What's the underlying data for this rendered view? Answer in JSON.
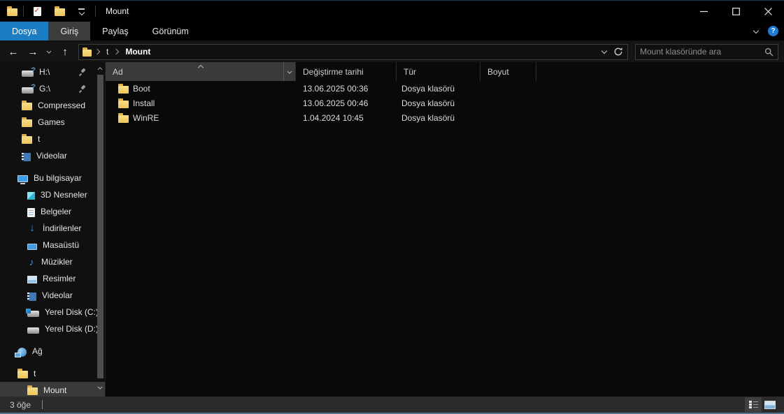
{
  "window": {
    "title": "Mount",
    "help_glyph": "?"
  },
  "titlebar": {
    "app_icon": "folder-icon",
    "quick_access_toolbar": [
      {
        "name": "properties-button",
        "icon": "properties-check-icon"
      },
      {
        "name": "new-folder-button",
        "icon": "folder-icon"
      },
      {
        "name": "customize-quick-access-button",
        "icon": "chevron-down-icon"
      }
    ]
  },
  "ribbon": {
    "tabs": [
      {
        "label": "Dosya",
        "style": "file-accent"
      },
      {
        "label": "Giriş",
        "style": "current"
      },
      {
        "label": "Paylaş",
        "style": "normal"
      },
      {
        "label": "Görünüm",
        "style": "normal"
      }
    ],
    "collapse_icon": "chevron-down-icon",
    "help_icon": "help-icon"
  },
  "navbar": {
    "back_icon": "←",
    "forward_icon": "→",
    "up_icon": "↑",
    "breadcrumb": {
      "root_icon": "folder-icon",
      "segments": [
        {
          "label": "t",
          "current": false
        },
        {
          "label": "Mount",
          "current": true
        }
      ]
    },
    "refresh_icon": "refresh-icon",
    "search": {
      "placeholder": "Mount klasöründe ara",
      "value": ""
    }
  },
  "sidebar": {
    "items": [
      {
        "label": "H:\\",
        "icon": "drive-question-icon",
        "level": 1,
        "pinned": true
      },
      {
        "label": "G:\\",
        "icon": "drive-question-icon",
        "level": 1,
        "pinned": true
      },
      {
        "label": "Compressed",
        "icon": "folder-icon",
        "level": 1,
        "pinned": false
      },
      {
        "label": "Games",
        "icon": "folder-icon",
        "level": 1,
        "pinned": false
      },
      {
        "label": "t",
        "icon": "folder-icon",
        "level": 1,
        "pinned": false
      },
      {
        "label": "Videolar",
        "icon": "videos-icon",
        "level": 1,
        "pinned": false
      },
      {
        "label": "Bu bilgisayar",
        "icon": "computer-icon",
        "level": 0,
        "pinned": false
      },
      {
        "label": "3D Nesneler",
        "icon": "3d-objects-icon",
        "level": 1,
        "pinned": false
      },
      {
        "label": "Belgeler",
        "icon": "documents-icon",
        "level": 1,
        "pinned": false
      },
      {
        "label": "İndirilenler",
        "icon": "downloads-icon",
        "level": 1,
        "pinned": false
      },
      {
        "label": "Masaüstü",
        "icon": "desktop-icon",
        "level": 1,
        "pinned": false
      },
      {
        "label": "Müzikler",
        "icon": "music-icon",
        "level": 1,
        "pinned": false
      },
      {
        "label": "Resimler",
        "icon": "pictures-icon",
        "level": 1,
        "pinned": false
      },
      {
        "label": "Videolar",
        "icon": "videos-icon",
        "level": 1,
        "pinned": false
      },
      {
        "label": "Yerel Disk (C:)",
        "icon": "drive-windows-icon",
        "level": 1,
        "pinned": false
      },
      {
        "label": "Yerel Disk (D:)",
        "icon": "drive-icon",
        "level": 1,
        "pinned": false
      },
      {
        "label": "Ağ",
        "icon": "network-icon",
        "level": 0,
        "pinned": false
      },
      {
        "label": "t",
        "icon": "folder-icon",
        "level": 0,
        "pinned": false
      },
      {
        "label": "Mount",
        "icon": "folder-icon",
        "level": 1,
        "pinned": false,
        "selected": true
      }
    ]
  },
  "main": {
    "columns": [
      {
        "label": "Ad",
        "sorted": "ascending"
      },
      {
        "label": "Değiştirme tarihi",
        "sorted": ""
      },
      {
        "label": "Tür",
        "sorted": ""
      },
      {
        "label": "Boyut",
        "sorted": ""
      }
    ],
    "rows": [
      {
        "name": "Boot",
        "icon": "folder-icon",
        "modified": "13.06.2025 00:36",
        "type": "Dosya klasörü",
        "size": ""
      },
      {
        "name": "Install",
        "icon": "folder-icon",
        "modified": "13.06.2025 00:46",
        "type": "Dosya klasörü",
        "size": ""
      },
      {
        "name": "WinRE",
        "icon": "folder-icon",
        "modified": "1.04.2024 10:45",
        "type": "Dosya klasörü",
        "size": ""
      }
    ]
  },
  "statusbar": {
    "item_count": "3 öğe"
  },
  "colors": {
    "accent_tab_blue": "#1d7dc2",
    "help_blue": "#1f78d1",
    "folder_yellow": "#f2d377",
    "sidebar_selection": "#3a3a3a",
    "bottom_border": "#51758c"
  }
}
